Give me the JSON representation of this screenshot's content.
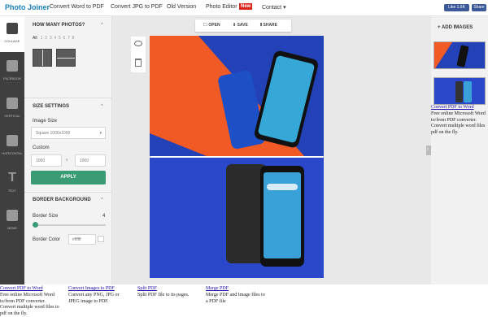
{
  "nav": {
    "logo": "Photo Joiner",
    "links": [
      "Convert Word to PDF",
      "Convert JPG to PDF",
      "Old Version",
      "Photo Editor",
      "Contact ▾"
    ],
    "new_badge": "New",
    "fb_like": "Like 1.6K",
    "fb_share": "Share"
  },
  "rail": {
    "items": [
      {
        "label": "Collage",
        "icon": "collage-icon"
      },
      {
        "label": "Facebook",
        "icon": "facebook-icon"
      },
      {
        "label": "Vertical",
        "icon": "vertical-icon"
      },
      {
        "label": "Horizontal",
        "icon": "horizontal-icon"
      },
      {
        "label": "Text",
        "icon": "text-icon"
      },
      {
        "label": "Meme",
        "icon": "meme-icon"
      }
    ]
  },
  "panel": {
    "how_many_title": "How many photos?",
    "counts": [
      "All",
      "1",
      "2",
      "3",
      "4",
      "5",
      "6",
      "7",
      "8"
    ],
    "size_title": "Size Settings",
    "image_size_label": "Image Size",
    "image_size_value": "Square 1000x1000",
    "custom_label": "Custom",
    "width_value": "1000",
    "times": "x",
    "height_value": "1000",
    "apply_label": "APPLY",
    "border_title": "Border Background",
    "border_size_label": "Border Size",
    "border_size_value": "4",
    "border_color_label": "Border Color",
    "border_color_value": "#ffffff"
  },
  "toolbar": {
    "open": "OPEN",
    "save": "SAVE",
    "share": "SHARE"
  },
  "right": {
    "add_images": "+ ADD IMAGES"
  },
  "right_ad": {
    "link": "Convert PDF to Word",
    "text": [
      "Free online Microsoft Word",
      "to/from PDF converter.",
      "Convert multiple word files",
      "pdf on the fly."
    ]
  },
  "bottom_ads": [
    {
      "link": "Convert PDF to Word",
      "text": [
        "Free online Microsoft Word",
        "to/from PDF converter.",
        "Convert multiple word files to",
        "pdf on the fly."
      ]
    },
    {
      "link": "Convert Images to PDF",
      "text": [
        "Convert any PNG, JPG or",
        "JPEG image to PDF."
      ]
    },
    {
      "link": "Split PDF",
      "text": [
        "Split PDF file to its pages."
      ]
    },
    {
      "link": "Merge PDF",
      "text": [
        "Merge PDF and Image files to",
        "a PDF file"
      ]
    }
  ],
  "colors": {
    "accent": "#3a9c74",
    "logo": "#1b7fb8",
    "new_badge": "#d9261c",
    "orange": "#f15a24",
    "blue": "#2a48c9"
  }
}
